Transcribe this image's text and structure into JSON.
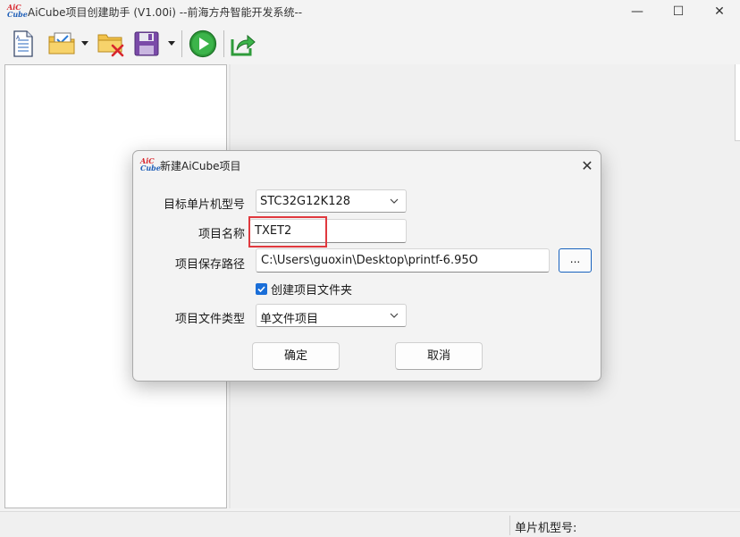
{
  "window": {
    "title": "AiCube项目创建助手 (V1.00i) --前海方舟智能开发系统--",
    "logo_top": "AiC",
    "logo_bottom": "Cube",
    "minimize": "—",
    "maximize": "☐",
    "close": "✕"
  },
  "toolbar": {
    "icons": [
      "new-document-icon",
      "open-project-icon",
      "close-project-icon",
      "save-icon",
      "run-icon",
      "export-icon"
    ]
  },
  "statusbar": {
    "mcu_label": "单片机型号:"
  },
  "dialog": {
    "title": "新建AiCube项目",
    "close": "✕",
    "labels": {
      "mcu": "目标单片机型号",
      "name": "项目名称",
      "path": "项目保存路径",
      "type": "项目文件类型"
    },
    "mcu_value": "STC32G12K128",
    "name_value": "TXET2",
    "path_value": "C:\\Users\\guoxin\\Desktop\\printf-6.95O",
    "browse_label": "...",
    "create_folder_label": "创建项目文件夹",
    "create_folder_checked": true,
    "type_value": "单文件项目",
    "ok_label": "确定",
    "cancel_label": "取消"
  },
  "colors": {
    "accent": "#1a6ed8",
    "highlight": "#e0393e",
    "run_green": "#2e9b3a"
  }
}
